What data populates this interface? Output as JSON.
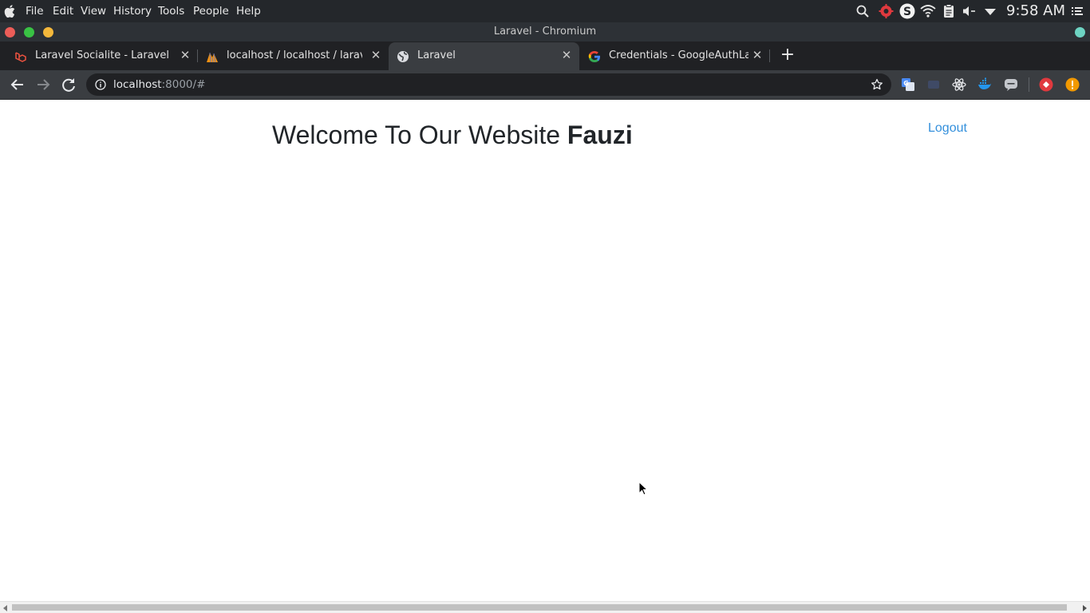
{
  "system_bar": {
    "menus": [
      "File",
      "Edit",
      "View",
      "History",
      "Tools",
      "People",
      "Help"
    ],
    "clock": "9:58 AM",
    "tray_icons": [
      "search-icon",
      "settings-gear-icon",
      "skype-icon",
      "wifi-icon",
      "clipboard-icon",
      "volume-muted-icon",
      "dropdown-arrow-icon",
      "list-menu-icon"
    ]
  },
  "window": {
    "title": "Laravel - Chromium"
  },
  "tabs": [
    {
      "title": "Laravel Socialite - Laravel - Th",
      "icon": "laravel-icon",
      "active": false
    },
    {
      "title": "localhost / localhost / laravel_",
      "icon": "phpmyadmin-icon",
      "active": false
    },
    {
      "title": "Laravel",
      "icon": "globe-icon",
      "active": true
    },
    {
      "title": "Credentials - GoogleAuthLara",
      "icon": "google-icon",
      "active": false
    }
  ],
  "toolbar": {
    "url_host": "localhost",
    "url_path": ":8000/#",
    "extensions": [
      "google-translate-icon",
      "extension-dim-icon",
      "react-devtools-icon",
      "docker-icon",
      "chat-bubble-icon",
      "red-extension-icon",
      "warning-icon"
    ]
  },
  "page": {
    "welcome_text": "Welcome To Our Website ",
    "user_name": "Fauzi",
    "logout_label": "Logout"
  },
  "colors": {
    "link": "#3490dc",
    "heading": "#212529",
    "tab_strip": "#202124",
    "toolbar": "#3a3d41"
  }
}
